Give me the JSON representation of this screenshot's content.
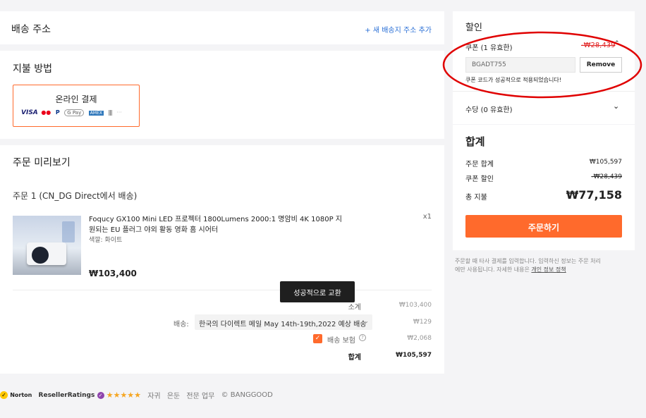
{
  "address": {
    "title": "배송 주소",
    "add_link": "+ 새 배송지 주소 추가"
  },
  "payment": {
    "title": "지불 방법",
    "option_label": "온라인 결제",
    "logos": [
      "VISA",
      "●●",
      "P",
      "G Pay",
      "AMEX",
      "|||",
      "···"
    ]
  },
  "preview": {
    "title": "주문 미리보기",
    "shipment_label": "주문 1 (CN_DG Direct에서 배송)",
    "product": {
      "name_line1": "Foqucy GX100 Mini LED 프로젝터 1800Lumens 2000:1 명암비 4K 1080P 지",
      "name_line2": "원되는 EU 플러그 야외 활동 영화 홈 시어터",
      "variant": "색깔: 화이트",
      "price": "₩103,400",
      "qty": "x1"
    },
    "toast": "성공적으로 교환",
    "subtotal_label": "소계",
    "subtotal_value": "₩103,400",
    "shipping_label": "배송:",
    "shipping_option": "한국의 다이렉트 메일 May 14th-19th,2022 예상 배송",
    "shipping_value": "₩129",
    "insurance_label": "배송 보험",
    "insurance_value": "₩2,068",
    "total_label": "합계",
    "total_value": "₩105,597"
  },
  "discount": {
    "title": "할인",
    "coupon_label": "쿠폰 (1 유효한)",
    "coupon_value": "-₩28,439",
    "coupon_code": "BGADT755",
    "remove_label": "Remove",
    "success_msg": "쿠폰 코드가 성공적으로 적용되었습니다!",
    "points_label": "수당 (0 유효한)"
  },
  "summary": {
    "title": "합계",
    "order_total_label": "주문 합계",
    "order_total_value": "₩105,597",
    "coupon_discount_label": "쿠폰 할인",
    "coupon_discount_value": "-₩28,439",
    "grand_total_label": "총 지불",
    "grand_total_value": "₩77,158",
    "checkout_label": "주문하기"
  },
  "notice": {
    "line1": "주문할 때 타사 결제를 입력합니다. 입력하신 정보는 주문 처리",
    "line2_prefix": "에만 사용됩니다. 자세한 내용은 ",
    "privacy_link": "개인 정보 정책"
  },
  "footer": {
    "norton": "Norton",
    "reseller": "ResellerRatings",
    "stars": "★★★★★",
    "links": [
      "자귀",
      "은둔",
      "전문 업무"
    ],
    "copyright": "© BANGGOOD"
  },
  "colors": {
    "accent": "#ff6a2c",
    "annotation": "#e00000"
  }
}
